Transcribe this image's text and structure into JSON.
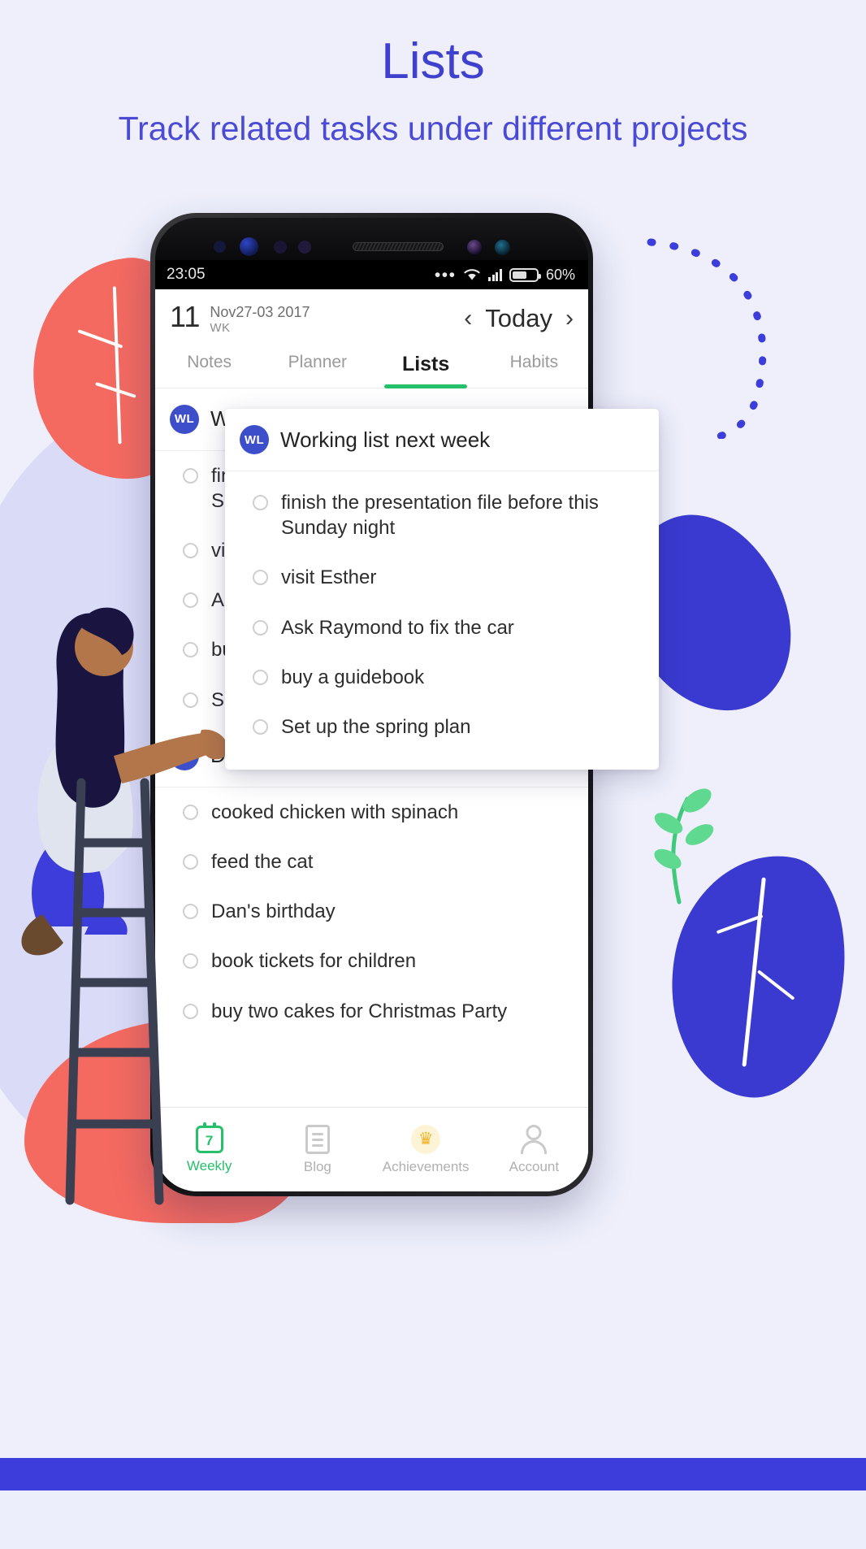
{
  "promo": {
    "title": "Lists",
    "subtitle": "Track related tasks under different projects",
    "title_color": "#4040cf"
  },
  "phone": {
    "status_bar": {
      "time": "23:05",
      "more_icon": "ellipsis-icon",
      "wifi_icon": "wifi-icon",
      "signal_icon": "cellular-signal-icon",
      "battery_icon": "battery-icon",
      "battery_percent": "60%"
    },
    "app_header": {
      "week_number": "11",
      "week_label": "WK",
      "date_range": "Nov27-03 2017",
      "prev_icon": "chevron-left-icon",
      "today_label": "Today",
      "next_icon": "chevron-right-icon"
    },
    "tabs": [
      {
        "label": "Notes",
        "active": false
      },
      {
        "label": "Planner",
        "active": false
      },
      {
        "label": "Lists",
        "active": true
      },
      {
        "label": "Habits",
        "active": false
      }
    ],
    "active_tab_color": "#27c06a",
    "lists": [
      {
        "avatar_initials": "WL",
        "avatar_color": "#3d4ecb",
        "title": "Working list next week",
        "tasks": [
          "finish the presentation file before this Sunday night",
          "visit Esther",
          "Ask Raymond to fix the car",
          "buy a guidebook",
          "Set up the spring plan"
        ]
      },
      {
        "avatar_initials": "DL",
        "avatar_color": "#3d4ecb",
        "title": "Daily life",
        "tasks": [
          "cooked chicken with spinach",
          "feed the cat",
          "Dan's birthday",
          "book tickets for children",
          "buy two cakes for Christmas Party"
        ]
      }
    ],
    "bottom_nav": [
      {
        "label": "Weekly",
        "icon": "calendar-icon",
        "badge": "7",
        "active": true
      },
      {
        "label": "Blog",
        "icon": "document-icon",
        "badge": "",
        "active": false
      },
      {
        "label": "Achievements",
        "icon": "trophy-icon",
        "badge": "",
        "active": false
      },
      {
        "label": "Account",
        "icon": "person-icon",
        "badge": "",
        "active": false
      }
    ]
  }
}
